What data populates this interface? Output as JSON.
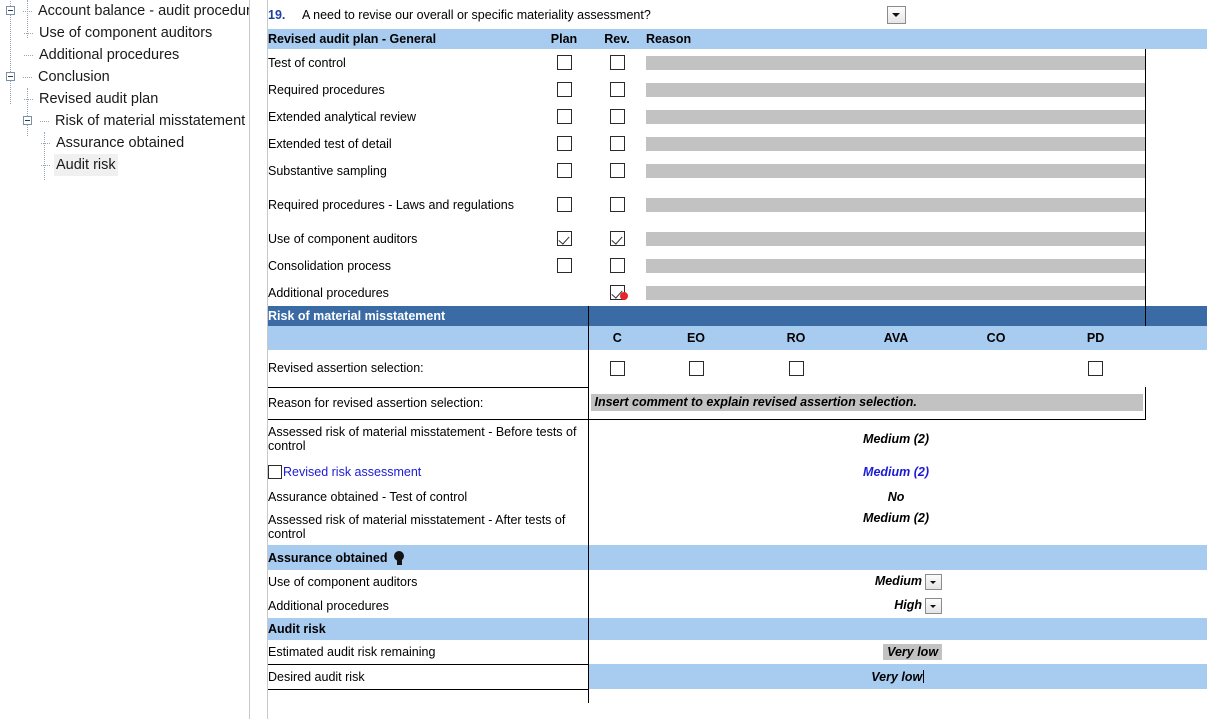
{
  "tree": {
    "nodes": [
      {
        "label": "Account balance - audit procedures",
        "depth": 0,
        "toggle": "minus",
        "selected": false
      },
      {
        "label": "Use of component auditors",
        "depth": 1,
        "toggle": "none",
        "selected": false
      },
      {
        "label": "Additional procedures",
        "depth": 1,
        "toggle": "none",
        "selected": false
      },
      {
        "label": "Conclusion",
        "depth": 0,
        "toggle": "minus",
        "selected": false
      },
      {
        "label": "Revised audit plan",
        "depth": 1,
        "toggle": "none",
        "selected": false
      },
      {
        "label": "Risk of material misstatement",
        "depth": 1,
        "toggle": "minus",
        "selected": false
      },
      {
        "label": "Assurance obtained",
        "depth": 2,
        "toggle": "none",
        "selected": false
      },
      {
        "label": "Audit risk",
        "depth": 2,
        "toggle": "none",
        "selected": true
      }
    ]
  },
  "question": {
    "number": "19.",
    "text": "A need to revise our overall or specific materiality assessment?",
    "answer_value": "",
    "dropdown_icon": "chevron-down-icon"
  },
  "revised_audit_plan": {
    "section_title": "Revised audit plan - General",
    "columns": {
      "plan": "Plan",
      "rev": "Rev.",
      "reason": "Reason"
    },
    "rows": [
      {
        "label": "Test of control",
        "plan": false,
        "rev": false,
        "reason": ""
      },
      {
        "label": "Required procedures",
        "plan": false,
        "rev": false,
        "reason": ""
      },
      {
        "label": "Extended analytical review",
        "plan": false,
        "rev": false,
        "reason": ""
      },
      {
        "label": "Extended test of detail",
        "plan": false,
        "rev": false,
        "reason": ""
      },
      {
        "label": "Substantive sampling",
        "plan": false,
        "rev": false,
        "reason": ""
      },
      {
        "label": "Required procedures - Laws and regulations",
        "plan": false,
        "rev": false,
        "reason": ""
      },
      {
        "label": "Use of component auditors",
        "plan": true,
        "rev": true,
        "reason": ""
      },
      {
        "label": "Consolidation process",
        "plan": false,
        "rev": false,
        "reason": ""
      },
      {
        "label": "Additional procedures",
        "plan": false,
        "rev": true,
        "reason": "",
        "cursor": true
      }
    ]
  },
  "risk_of_material_misstatement": {
    "section_title": "Risk of material misstatement",
    "assertion_columns": [
      "C",
      "EO",
      "RO",
      "AVA",
      "CO",
      "PD"
    ],
    "revised_assertion_selection": {
      "label": "Revised assertion selection:",
      "checkbox_present": [
        true,
        true,
        true,
        false,
        false,
        true
      ],
      "checked": [
        false,
        false,
        false,
        false,
        false,
        false
      ]
    },
    "reason_row": {
      "label": "Reason for revised assertion selection:",
      "value": "Insert comment to explain revised assertion selection."
    },
    "rows": [
      {
        "label": "Assessed risk of material misstatement - Before tests of control",
        "values": [
          "",
          "",
          "",
          "Medium (2)",
          "",
          ""
        ],
        "style": "bold-italic"
      },
      {
        "label": "Revised risk assessment",
        "label_style": "link",
        "has_checkbox": true,
        "checked": false,
        "values": [
          "",
          "",
          "",
          "Medium (2)",
          "",
          ""
        ],
        "style": "bold-italic-blue"
      },
      {
        "label": "Assurance obtained - Test of control",
        "values": [
          "",
          "",
          "",
          "No",
          "",
          ""
        ],
        "style": "bold-italic"
      },
      {
        "label": "Assessed risk of material misstatement - After tests of control",
        "values": [
          "",
          "",
          "",
          "Medium (2)",
          "",
          ""
        ],
        "style": "bold-italic"
      }
    ]
  },
  "assurance_obtained": {
    "section_title": "Assurance obtained",
    "hint_icon": "lightbulb-icon",
    "rows": [
      {
        "label": "Use of component auditors",
        "value": "Medium",
        "control": "dropdown",
        "column": 3
      },
      {
        "label": "Additional procedures",
        "value": "High",
        "control": "dropdown",
        "column": 3
      }
    ]
  },
  "audit_risk": {
    "section_title": "Audit risk",
    "rows": [
      {
        "label": "Estimated audit risk remaining",
        "value": "Very low",
        "style": "highlight",
        "column": 3
      },
      {
        "label": "Desired audit risk",
        "value": "Very low",
        "style": "merged-blue",
        "cursor": true
      }
    ]
  },
  "colors": {
    "header_dark_blue": "#3b6ba5",
    "header_light_blue": "#a8cbf0",
    "grey_field": "#c2c2c2",
    "link_blue": "#1b1bd6",
    "question_number_blue": "#1f3fa0",
    "cursor_red": "#e8252a"
  }
}
